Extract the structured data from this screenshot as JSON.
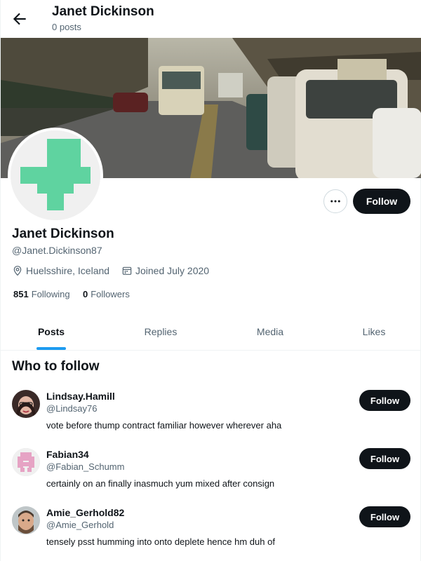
{
  "header": {
    "title": "Janet Dickinson",
    "posts_count": "0 posts"
  },
  "profile": {
    "name": "Janet Dickinson",
    "handle": "@Janet.Dickinson87",
    "location": "Huelsshire, Iceland",
    "joined": "Joined July 2020",
    "following_count": "851",
    "following_label": "Following",
    "followers_count": "0",
    "followers_label": "Followers",
    "follow_label": "Follow",
    "avatar_color": "#5fd3a0"
  },
  "tabs": [
    {
      "label": "Posts",
      "active": true
    },
    {
      "label": "Replies",
      "active": false
    },
    {
      "label": "Media",
      "active": false
    },
    {
      "label": "Likes",
      "active": false
    }
  ],
  "who_to_follow": {
    "title": "Who to follow",
    "items": [
      {
        "name": "Lindsay.Hamill",
        "handle": "@Lindsay76",
        "bio": "vote before thump contract familiar however wherever aha",
        "follow_label": "Follow"
      },
      {
        "name": "Fabian34",
        "handle": "@Fabian_Schumm",
        "bio": "certainly on an finally inasmuch yum mixed after consign",
        "follow_label": "Follow"
      },
      {
        "name": "Amie_Gerhold82",
        "handle": "@Amie_Gerhold",
        "bio": "tensely psst humming into onto deplete hence hm duh of",
        "follow_label": "Follow"
      }
    ]
  },
  "colors": {
    "accent": "#1d9bf0",
    "button_dark": "#0f1419",
    "secondary_text": "#536471"
  }
}
